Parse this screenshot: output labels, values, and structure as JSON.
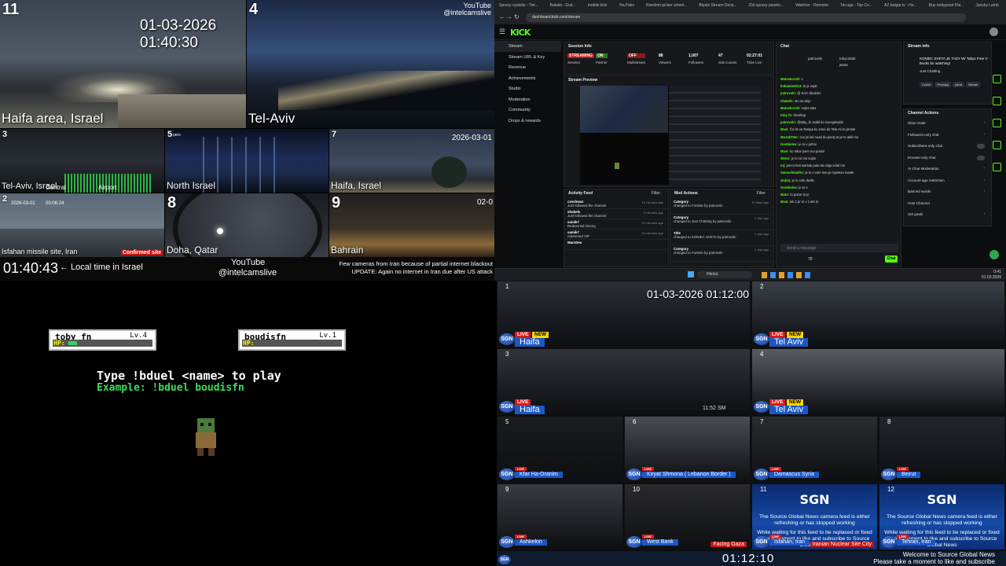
{
  "q1": {
    "channel_top": "YouTube",
    "handle_top": "@intelcamslive",
    "top_left_cam": {
      "num": "11",
      "label": "Haifa area, Israel",
      "timestamp": "01-03-2026 01:40:30"
    },
    "top_right_cam": {
      "num": "4",
      "label": "Tel-Aviv"
    },
    "row2": [
      {
        "num": "3",
        "label": "Tel-Aviv, Israel",
        "extra1": "Central",
        "extra2": "Airport"
      },
      {
        "num": "5",
        "label": "North Israel",
        "tag": "pers"
      },
      {
        "num": "7",
        "label": "Haifa, Israel",
        "timestamp": "2026-03-01"
      }
    ],
    "row3": [
      {
        "num": "2",
        "label": "Isfahan missile site, Iran",
        "timestamp": "2026-03-01",
        "time2": "00:06:24",
        "badge": "Confirmed site"
      },
      {
        "num": "8",
        "label": "Doha, Qatar"
      },
      {
        "num": "9",
        "label": "Bahrain",
        "tag": "02-0"
      }
    ],
    "clock": "01:40:43",
    "clock_note": "← Local time in Israel",
    "channel_bottom": "YouTube",
    "handle_bottom": "@intelcamslive",
    "notice_line1": "Few cameras from Iran because of partial internet blackout",
    "notice_line2": "UPDATE: Again no internet in Iran due after US attack"
  },
  "game": {
    "player1": {
      "name": "toby_fn",
      "level": "Lv.4",
      "hp_label": "HP:",
      "hp_fraction": 0.1
    },
    "player2": {
      "name": "boudisfn",
      "level": "Lv.1",
      "hp_label": "HP:",
      "hp_fraction": 0.0
    },
    "instruction": "Type !bduel <name> to play",
    "example": "Example: !bduel boudisfn"
  },
  "kick": {
    "tabs": [
      "Spravy vysloše - Twi...",
      "Babaki - Guš...",
      "mobile.kick",
      "YouTube",
      "Random picker wheel...",
      "Blyats Stream Deck...",
      "Zlol spravy panelu...",
      "Watcher - Remoter",
      "Tar.ugo - Top Co...",
      "AZ bulgar.tv - Ho...",
      "Buy nettypesé Pal...",
      "Junsky Lamb"
    ],
    "url": "dashboard.kick.com/stream",
    "logo": "KICK",
    "nav": [
      "Stream",
      "Stream URL & Key",
      "Revenue",
      "Achievements",
      "Studio",
      "Moderation",
      "Community",
      "Drops & rewards"
    ],
    "session_info": {
      "title": "Session Info",
      "stats": [
        {
          "value": "STREAMING",
          "label": "Session"
        },
        {
          "value": "ON",
          "label": "Partner"
        },
        {
          "value": "OFF",
          "label": "Multistream"
        },
        {
          "value": "88",
          "label": "Viewers"
        },
        {
          "value": "1,007",
          "label": "Followers"
        },
        {
          "value": "47",
          "label": "Sub Counts"
        },
        {
          "value": "02:27:01",
          "label": "Time Live"
        }
      ]
    },
    "stream_preview": {
      "title": "Stream Preview"
    },
    "activity_feed": {
      "title": "Activity Feed",
      "filter": "Filter",
      "rows": [
        {
          "user": "czechwax",
          "text": "Just followed the channel",
          "time": "15 minutes ago"
        },
        {
          "user": "shakefs",
          "text": "Just followed the channel",
          "time": "3 minutes ago"
        },
        {
          "user": "samik7",
          "text": "Redeemed Strong",
          "time": "22 minutes ago"
        },
        {
          "user": "samik7",
          "text": "redeemed VIP",
          "time": "24 minutes ago"
        },
        {
          "user": "MarcDex",
          "text": "",
          "time": ""
        }
      ]
    },
    "mod_actions": {
      "title": "Mod Actions",
      "filter": "Filter",
      "rows": [
        {
          "user": "Category",
          "text": "changed to Fortnite by patrovski",
          "time": "13 days ago"
        },
        {
          "user": "Category",
          "text": "changed to Just Chatting by patrovski",
          "time": "1 day ago"
        },
        {
          "user": "Title",
          "text": "changed to KONIEC SVETA by patrovski",
          "time": "1 day ago"
        },
        {
          "user": "Category",
          "text": "changed to Fortnite by patrovski",
          "time": "1 day ago"
        }
      ]
    },
    "chat": {
      "title": "Chat",
      "pinned_users": [
        "patrovski",
        "tobycobalt",
        "janas"
      ],
      "lines": [
        {
          "user": "Matusko132:",
          "text": "1"
        },
        {
          "user": "kobamisek13:",
          "text": "to je vojst"
        },
        {
          "user": "patrovski:",
          "text": "@ SAC Skulek1"
        },
        {
          "user": "shakefs:",
          "text": "sto sa deje"
        },
        {
          "user": "Matusko132:",
          "text": "vojna stax"
        },
        {
          "user": "toby fn:",
          "text": "tleveltup"
        },
        {
          "user": "patrovski:",
          "text": "@toby_fn zaldil do navzgelejsle"
        },
        {
          "user": "MaxI:",
          "text": "Čo ist ve Tampa ku zone do Tele mi to proste"
        },
        {
          "user": "MoJ4kT0er:",
          "text": "cuz jsi lali nuad do pindy at je to ublil mo"
        },
        {
          "user": "Gombolov:",
          "text": "je to v pohoi"
        },
        {
          "user": "MaxI:",
          "text": "no nikor jsem mu posloi"
        },
        {
          "user": "demo:",
          "text": "je to zo mo sojim"
        },
        {
          "user": "mj:",
          "text": "preco heti warsak pata stv daja vetal mo"
        },
        {
          "user": "Samuelmadrin:",
          "text": "je to v celo Iran je mysstvo maste"
        },
        {
          "user": "wojtoj:",
          "text": "je to celo dodlo"
        },
        {
          "user": "Gombolov:",
          "text": "je to s"
        },
        {
          "user": "Mato:",
          "text": "to pozor to je"
        },
        {
          "user": "MaxI:",
          "text": "asi 2 pr m v 1 ale ty"
        }
      ],
      "send_placeholder": "Send a message",
      "send_button": "Chat",
      "viewer_count": "78"
    },
    "stream_info": {
      "title": "Stream info",
      "stream_title": "KONIEC SVETA JE TADY W/ Tabys Free V-Bucks for watching!",
      "category": "Just Chatting",
      "tags": [
        "Czech",
        "Prepojoj",
        "ydrat",
        "Slovak"
      ]
    },
    "channel_actions": {
      "title": "Channel Actions",
      "items": [
        {
          "label": "Slow mode",
          "kind": "arrow"
        },
        {
          "label": "Followers-only chat",
          "kind": "arrow"
        },
        {
          "label": "Subscribers-only chat",
          "kind": "toggle"
        },
        {
          "label": "Emotes-only chat",
          "kind": "toggle"
        },
        {
          "label": "AI Chat Moderation",
          "kind": "arrow"
        },
        {
          "label": "Account age restriction",
          "kind": "arrow"
        },
        {
          "label": "Banned words",
          "kind": "arrow"
        },
        {
          "label": "Host Channel",
          "kind": "none"
        },
        {
          "label": "Set goals",
          "kind": "arrow"
        }
      ]
    },
    "taskbar": {
      "search": "Hledat",
      "clock": "0:41",
      "date": "01.03.2026"
    }
  },
  "q4": {
    "timestamp": "01-03-2026 01:12:00",
    "clock": "01:12:10",
    "tiles": [
      {
        "num": "1",
        "city": "Haifa",
        "live": "LIVE",
        "new": "NEW",
        "size": "big"
      },
      {
        "num": "2",
        "city": "Tel Aviv",
        "live": "LIVE",
        "new": "NEW",
        "size": "big"
      },
      {
        "num": "3",
        "city": "Haifa",
        "live": "LIVE",
        "new": "",
        "size": "big"
      },
      {
        "num": "4",
        "city": "Tel Aviv",
        "live": "LIVE",
        "new": "NEW",
        "size": "big"
      },
      {
        "num": "5",
        "city": "Kfar Ha-Oranim",
        "live": "LIVE",
        "size": "small"
      },
      {
        "num": "6",
        "city": "Kiryat Shmona ( Lebanon Border )",
        "live": "LIVE",
        "size": "small"
      },
      {
        "num": "7",
        "city": "Damascus Syria",
        "live": "LIVE",
        "size": "small"
      },
      {
        "num": "8",
        "city": "Beirut",
        "live": "LIVE",
        "size": "small"
      },
      {
        "num": "9",
        "city": "Ashkelon",
        "live": "LIVE",
        "size": "small"
      },
      {
        "num": "10",
        "city": "West Bank",
        "extra": "Facing Gaza",
        "live": "LIVE",
        "size": "small"
      },
      {
        "num": "11",
        "city": "Isfahan, Iran",
        "extra": "Iranian Nuclear Site City",
        "live": "LIVE",
        "size": "offline"
      },
      {
        "num": "12",
        "city": "Tehran, Iran",
        "live": "LIVE",
        "size": "offline"
      }
    ],
    "offline_logo": "SGN",
    "offline_msg": "The Source Global News camera feed is either refreshing or has stopped working",
    "offline_msg2": "While waiting for this feed to be replaced or fixed take a moment to like and subscribe to Source Global News",
    "footer_line1": "Welcome to Source Global News",
    "footer_line2": "Please take a moment to like and subscribe",
    "time_overlay": "11:52 SM"
  },
  "colors": {
    "kick_green": "#53fc18",
    "sgn_blue": "#1c57c4",
    "live_red": "#d91b1b",
    "new_yellow": "#ffd400"
  }
}
